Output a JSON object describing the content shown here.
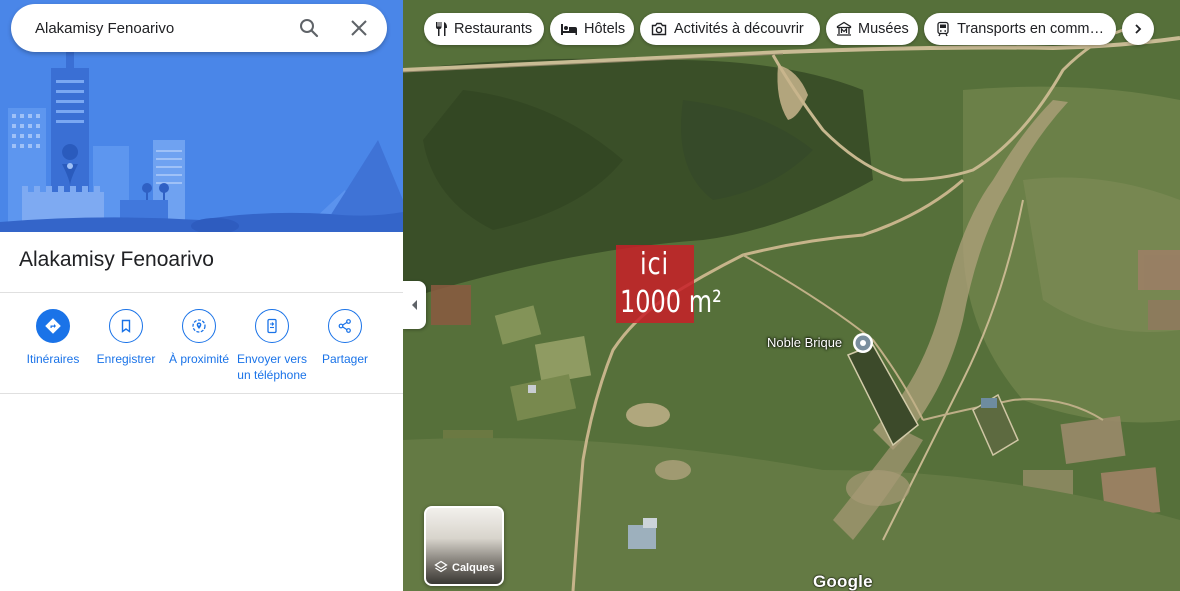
{
  "search": {
    "value": "Alakamisy Fenoarivo"
  },
  "place": {
    "title": "Alakamisy Fenoarivo"
  },
  "actions": [
    {
      "label": "Itinéraires",
      "icon": "directions-icon"
    },
    {
      "label": "Enregistrer",
      "icon": "bookmark-icon"
    },
    {
      "label": "À proximité",
      "icon": "nearby-icon"
    },
    {
      "label": "Envoyer vers un téléphone",
      "icon": "send-to-phone-icon"
    },
    {
      "label": "Partager",
      "icon": "share-icon"
    }
  ],
  "chips": [
    {
      "label": "Restaurants",
      "icon": "restaurant-icon"
    },
    {
      "label": "Hôtels",
      "icon": "hotel-icon"
    },
    {
      "label": "Activités à découvrir",
      "icon": "camera-icon"
    },
    {
      "label": "Musées",
      "icon": "museum-icon"
    },
    {
      "label": "Transports en comm…",
      "icon": "transit-icon"
    }
  ],
  "map": {
    "annotation": {
      "line1": "ici",
      "line2": "1000 m²"
    },
    "poi": {
      "label": "Noble Brique"
    },
    "layers_label": "Calques",
    "logo": "Google"
  },
  "colors": {
    "accent": "#1a73e8",
    "hero": "#4a86e8",
    "annotation": "#c81e28"
  }
}
